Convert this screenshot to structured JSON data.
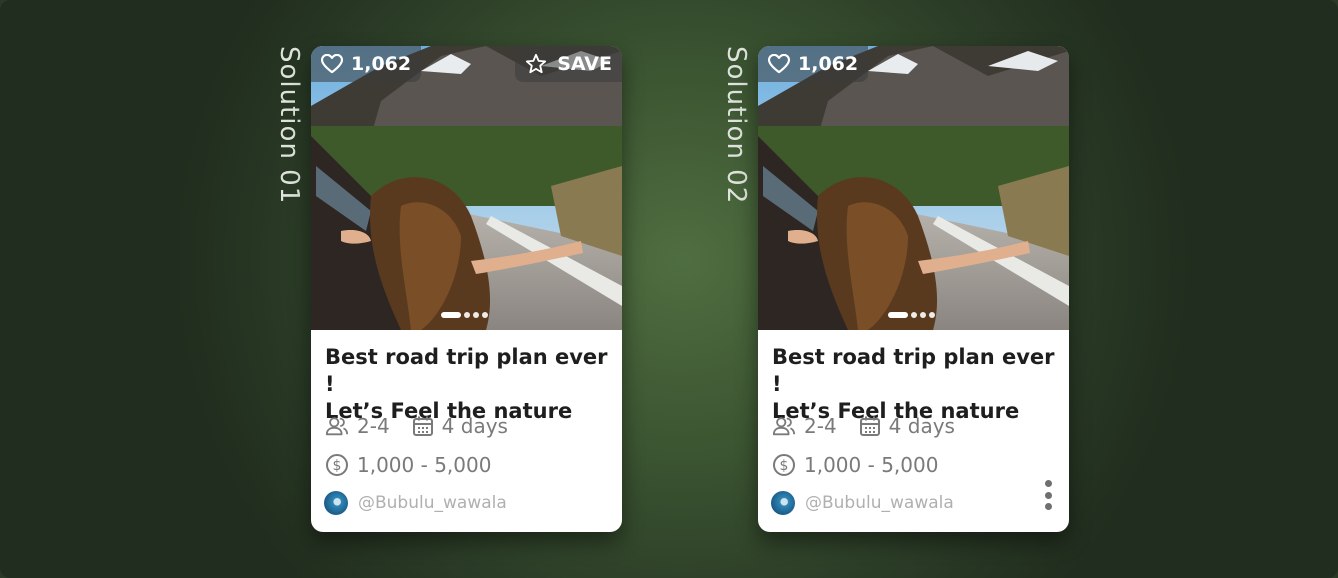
{
  "canvas": {
    "background": "#3b5431"
  },
  "solutions": [
    {
      "label": "Solution 01",
      "likes": "1,062",
      "save_label": "SAVE",
      "title_lines": [
        "Best road trip plan ever !",
        "Let’s Feel the nature"
      ],
      "people": "2-4",
      "duration": "4 days",
      "price": "1,000 -  5,000",
      "author": "@Bubulu_wawala",
      "carousel": {
        "pages": 4,
        "active": 1
      },
      "icons": [
        "heart-icon",
        "star-icon",
        "people-icon",
        "calendar-icon",
        "dollar-icon"
      ]
    },
    {
      "label": "Solution 02",
      "likes": "1,062",
      "title_lines": [
        "Best road trip plan ever !",
        "Let’s Feel the nature"
      ],
      "people": "2-4",
      "duration": "4 days",
      "price": "1,000 -  5,000",
      "author": "@Bubulu_wawala",
      "carousel": {
        "pages": 4,
        "active": 1
      },
      "icons": [
        "heart-icon",
        "people-icon",
        "calendar-icon",
        "dollar-icon",
        "more-vertical-icon"
      ]
    }
  ]
}
